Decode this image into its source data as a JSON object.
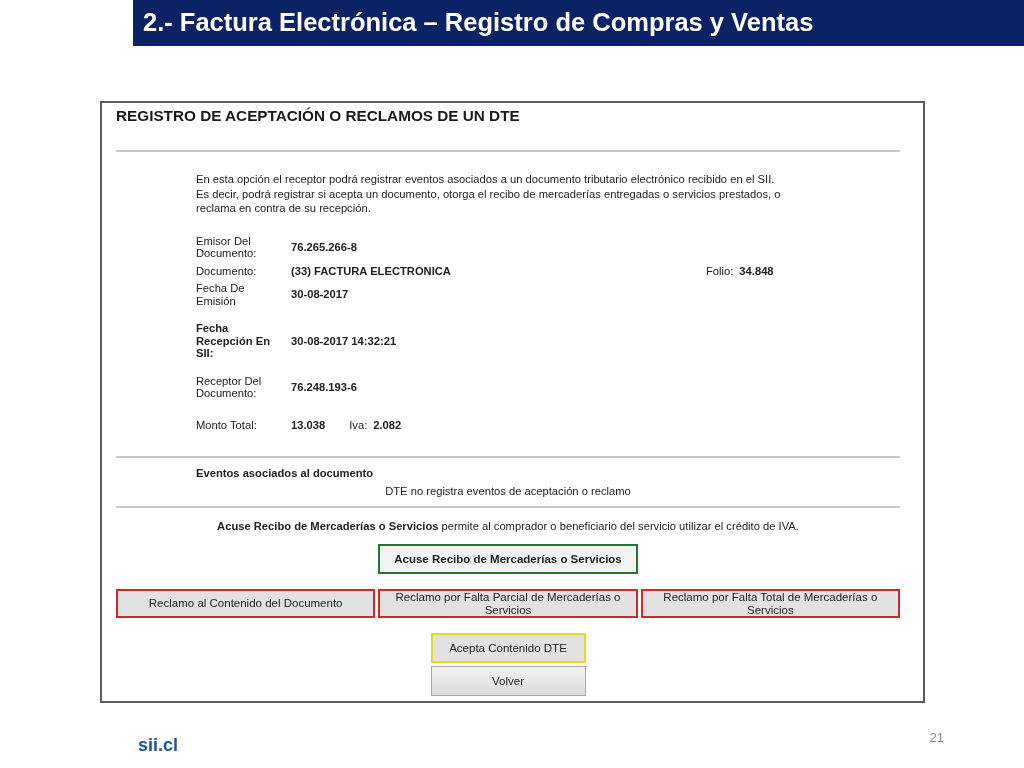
{
  "slide": {
    "title": "2.- Factura Electrónica – Registro de Compras y Ventas"
  },
  "form": {
    "title": "REGISTRO DE ACEPTACIÓN O RECLAMOS DE UN DTE",
    "intro": [
      "En esta opción el receptor podrá registrar eventos asociados a un documento tributario electrónico recibido en el SII.",
      "Es decir, podrá registrar si acepta un documento, otorga el recibo de mercaderías entregadas o servicios prestados, o reclama en contra de su recepción."
    ],
    "fields": [
      {
        "label": "Emisor Del Documento:",
        "value": "76.265.266-8",
        "highlighted": false
      },
      {
        "label": "Documento:",
        "value": "(33) FACTURA ELECTRONICA",
        "highlighted": false,
        "extra": {
          "kind": "far",
          "label": "Folio:",
          "value": "34.848"
        }
      },
      {
        "label": "Fecha De Emisión",
        "value": "30-08-2017",
        "highlighted": false
      },
      {
        "label": "Fecha Recepción En SII:",
        "value": "30-08-2017 14:32:21",
        "highlighted": true
      },
      {
        "label": "Receptor Del Documento:",
        "value": "76.248.193-6",
        "highlighted": false
      },
      {
        "label": "Monto Total:",
        "value": "13.038",
        "highlighted": false,
        "extra": {
          "kind": "inline",
          "label": "Iva:",
          "value": "2.082"
        }
      }
    ],
    "events": {
      "title": "Eventos asociados al documento",
      "message": "DTE no registra eventos de aceptación o reclamo"
    },
    "notice": "**Acuse Recibo de Mercaderías o Servicios** permite al comprador o beneficiario del servicio utilizar el crédito de IVA.",
    "receipt_button": "Acuse Recibo de Mercaderías o Servicios",
    "claim_buttons": [
      "Reclamo al Contenido del Documento",
      "Reclamo por Falta Parcial de Mercaderías o Servicios",
      "Reclamo por Falta Total de Mercaderías o Servicios"
    ],
    "accept_button": "Acepta Contenido DTE",
    "back_button": "Volver"
  },
  "footer": {
    "logo": "sii.cl",
    "page_number": "21"
  }
}
